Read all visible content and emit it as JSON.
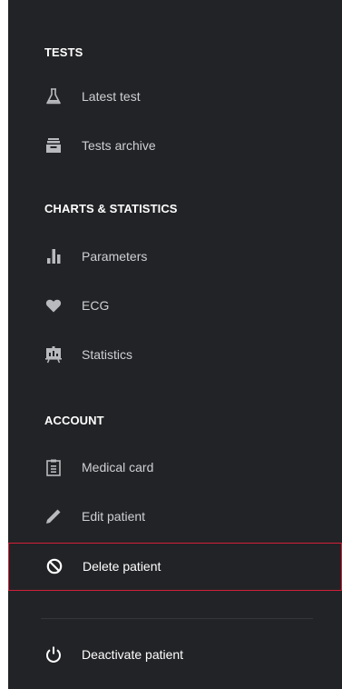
{
  "sections": {
    "tests": {
      "title": "TESTS",
      "items": [
        {
          "label": "Latest test",
          "icon": "flask-icon"
        },
        {
          "label": "Tests archive",
          "icon": "archive-icon"
        }
      ]
    },
    "charts": {
      "title": "CHARTS & STATISTICS",
      "items": [
        {
          "label": "Parameters",
          "icon": "bar-chart-icon"
        },
        {
          "label": "ECG",
          "icon": "heart-icon"
        },
        {
          "label": "Statistics",
          "icon": "presentation-chart-icon"
        }
      ]
    },
    "account": {
      "title": "ACCOUNT",
      "items": [
        {
          "label": "Medical card",
          "icon": "clipboard-icon"
        },
        {
          "label": "Edit patient",
          "icon": "pencil-icon"
        },
        {
          "label": "Delete patient",
          "icon": "block-icon"
        }
      ]
    }
  },
  "footer": {
    "deactivate": {
      "label": "Deactivate patient",
      "icon": "power-icon"
    }
  },
  "colors": {
    "background": "#222326",
    "heading": "#ffffff",
    "label": "#cfd0d3",
    "icon": "#b8babe",
    "highlight_border": "#d31f3a"
  }
}
